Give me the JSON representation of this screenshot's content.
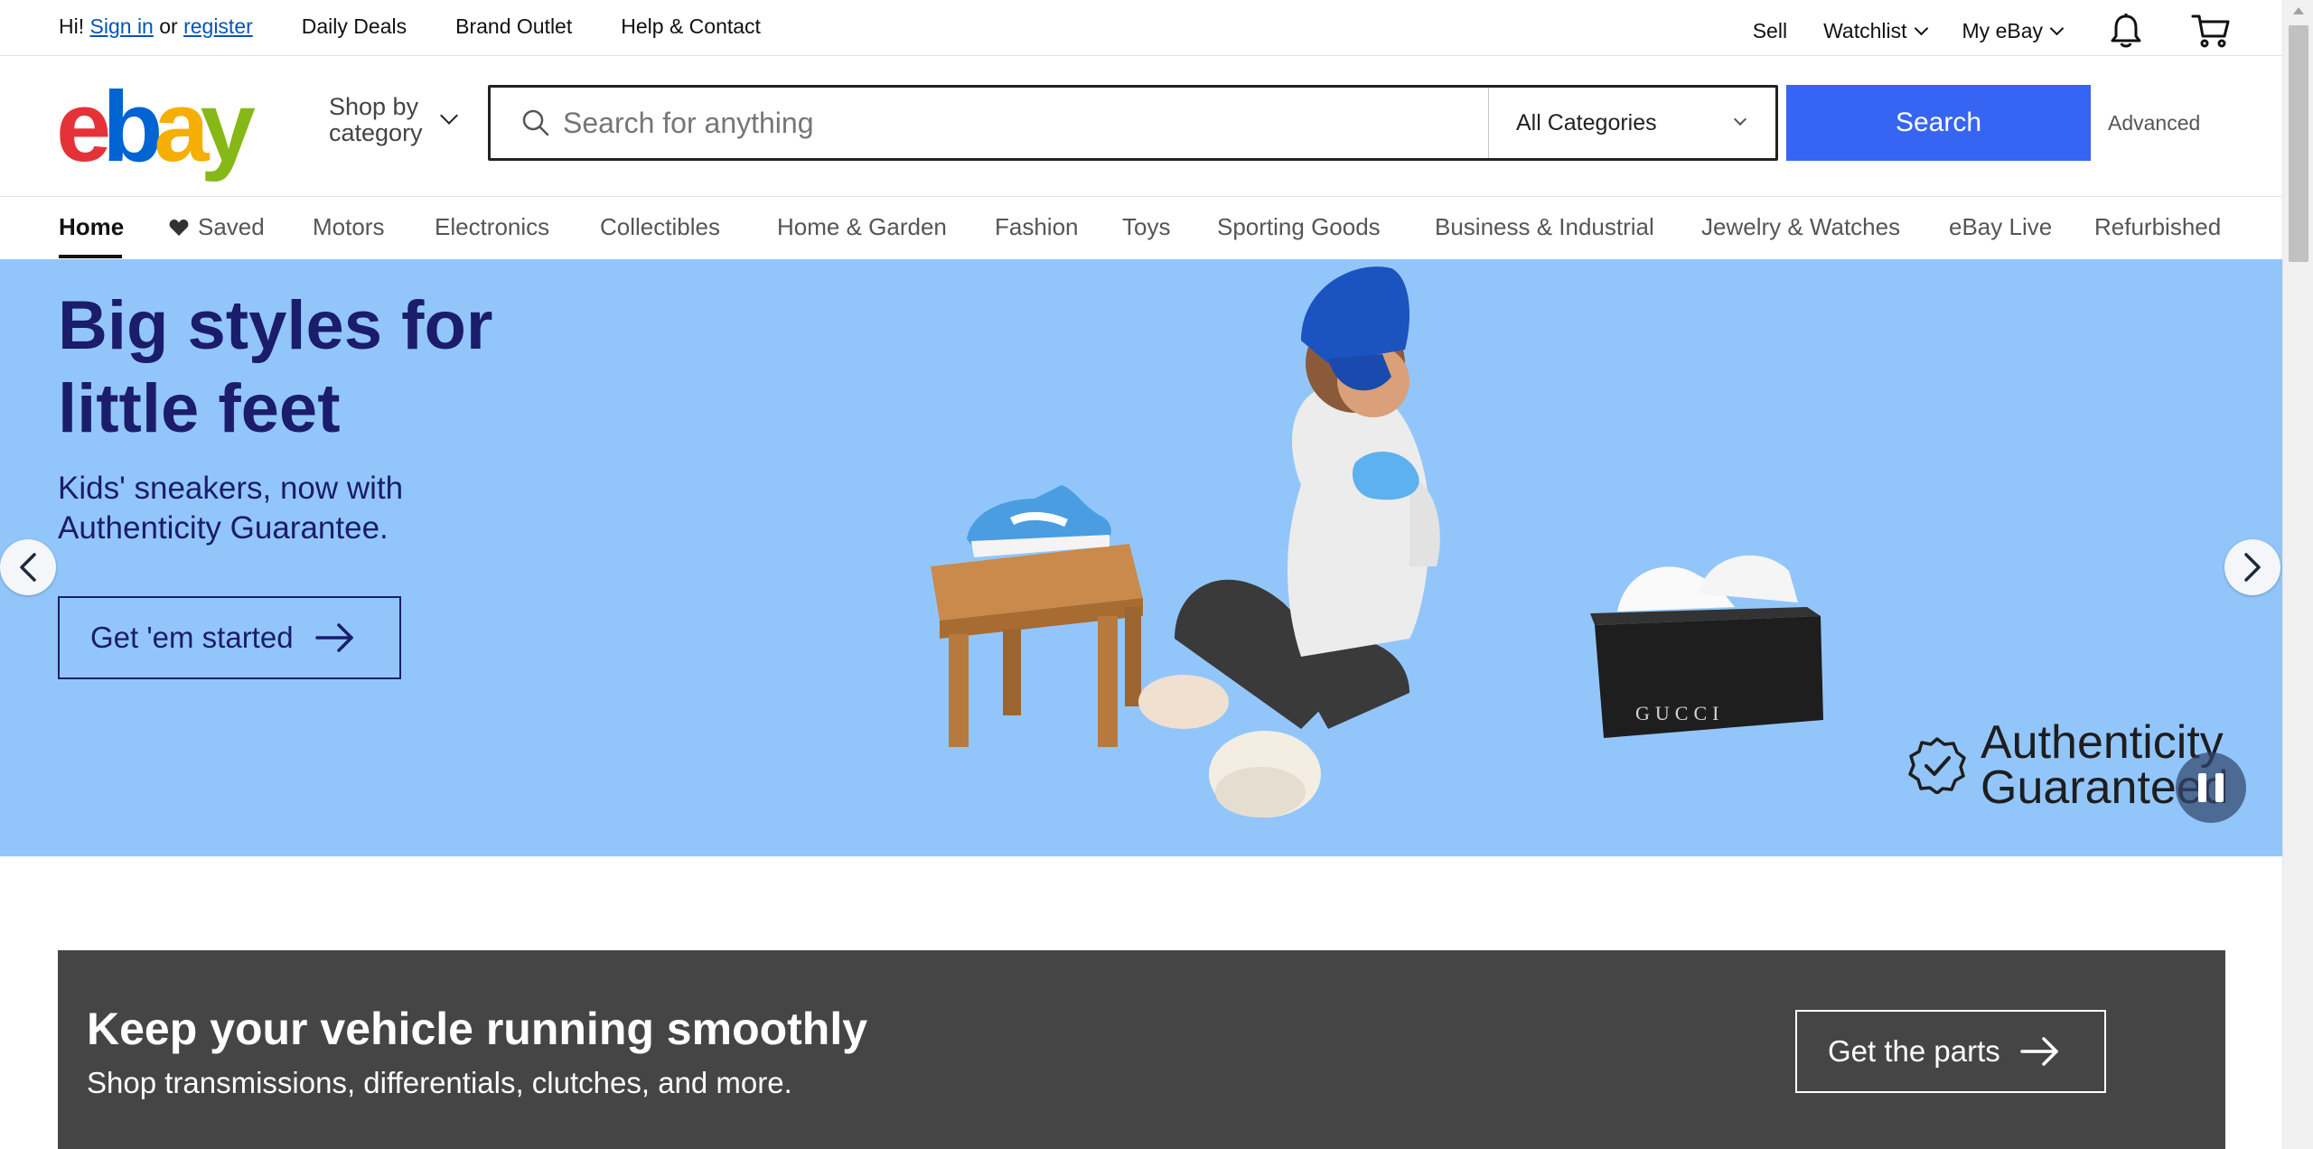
{
  "topbar": {
    "greeting": "Hi!",
    "sign_in": "Sign in",
    "or": "or",
    "register": "register",
    "links": [
      "Daily Deals",
      "Brand Outlet",
      "Help & Contact"
    ],
    "sell": "Sell",
    "watchlist": "Watchlist",
    "myebay": "My eBay",
    "icons": [
      "bell-icon",
      "cart-icon"
    ]
  },
  "header": {
    "logo": {
      "e": "e",
      "b": "b",
      "a": "a",
      "y": "y"
    },
    "logo_colors": {
      "e": "#e53238",
      "b": "#0064d2",
      "a": "#f5af02",
      "y": "#86b817"
    },
    "shop_by_line1": "Shop by",
    "shop_by_line2": "category",
    "search_placeholder": "Search for anything",
    "search_value": "",
    "category_selected": "All Categories",
    "search_button": "Search",
    "advanced": "Advanced",
    "accent_color": "#3665f3"
  },
  "nav": {
    "items": [
      "Home",
      "Saved",
      "Motors",
      "Electronics",
      "Collectibles",
      "Home & Garden",
      "Fashion",
      "Toys",
      "Sporting Goods",
      "Business & Industrial",
      "Jewelry & Watches",
      "eBay Live",
      "Refurbished"
    ],
    "active": "Home"
  },
  "hero": {
    "title": "Big styles for little feet",
    "subtitle": "Kids' sneakers, now with Authenticity Guarantee.",
    "cta": "Get 'em started",
    "badge_line1": "Authenticity",
    "badge_line2": "Guaranteed",
    "box_label": "GUCCI",
    "background": "#92c6fb"
  },
  "promo": {
    "title": "Keep your vehicle running smoothly",
    "subtitle": "Shop transmissions, differentials, clutches, and more.",
    "cta": "Get the parts",
    "background": "#454545"
  }
}
